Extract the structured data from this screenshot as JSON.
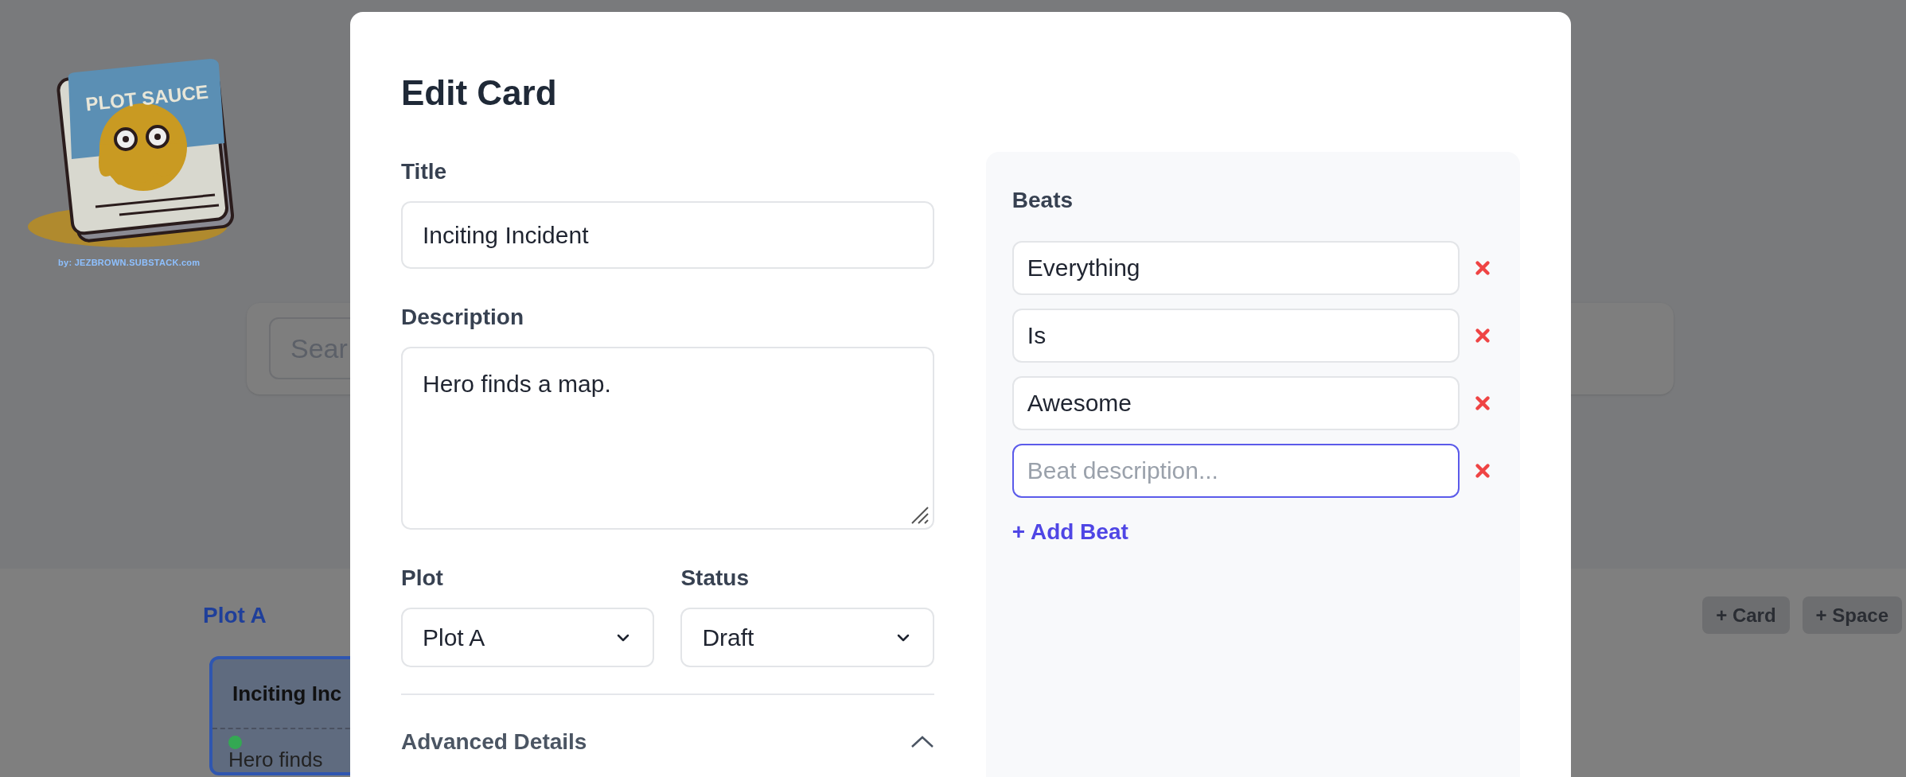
{
  "logo": {
    "title": "PLOT SAUCE",
    "credit": "by: JEZBROWN.SUBSTACK.com"
  },
  "search": {
    "placeholder": "Sear"
  },
  "board": {
    "plot_heading": "Plot A",
    "buttons": [
      "+ Card",
      "+ Space"
    ],
    "card": {
      "title": "Inciting Inc",
      "description": "Hero finds"
    }
  },
  "modal": {
    "title": "Edit Card",
    "fields": {
      "title_label": "Title",
      "title_value": "Inciting Incident",
      "description_label": "Description",
      "description_value": "Hero finds a map.",
      "plot_label": "Plot",
      "plot_value": "Plot A",
      "status_label": "Status",
      "status_value": "Draft"
    },
    "advanced": {
      "label": "Advanced Details",
      "expanded": true
    },
    "beats": {
      "label": "Beats",
      "items": [
        {
          "value": "Everything",
          "focused": false
        },
        {
          "value": "Is",
          "focused": false
        },
        {
          "value": "Awesome",
          "focused": false
        },
        {
          "placeholder": "Beat description...",
          "focused": true
        }
      ],
      "add_label": "+ Add Beat"
    }
  }
}
